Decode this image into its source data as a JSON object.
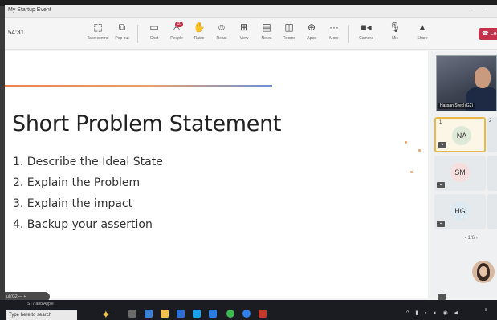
{
  "window": {
    "title": "My Startup Event"
  },
  "toolbar": {
    "timer": "54:31",
    "buttons": [
      {
        "label": "Take control",
        "icon": "take-control-icon"
      },
      {
        "label": "Pop out",
        "icon": "pop-out-icon"
      },
      {
        "label": "Chat",
        "icon": "chat-icon"
      },
      {
        "label": "People",
        "icon": "people-icon",
        "badge": "10"
      },
      {
        "label": "Raise",
        "icon": "raise-hand-icon"
      },
      {
        "label": "React",
        "icon": "react-icon"
      },
      {
        "label": "View",
        "icon": "view-icon"
      },
      {
        "label": "Notes",
        "icon": "notes-icon"
      },
      {
        "label": "Rooms",
        "icon": "rooms-icon"
      },
      {
        "label": "Apps",
        "icon": "apps-icon"
      },
      {
        "label": "More",
        "icon": "more-icon"
      },
      {
        "label": "Camera",
        "icon": "camera-icon"
      },
      {
        "label": "Mic",
        "icon": "mic-icon"
      },
      {
        "label": "Share",
        "icon": "share-icon"
      }
    ],
    "leave_label": "Le",
    "leave_color": "#c4314b"
  },
  "slide": {
    "title": "Short Problem Statement",
    "items": [
      "1. Describe the Ideal State",
      "2. Explain the Problem",
      "3. Explain the impact",
      "4. Backup your assertion"
    ],
    "stage_label": "ul (G2"
  },
  "participants": {
    "presenter_name": "Hassan Syed (G2)",
    "tiles": [
      {
        "initials": "NA",
        "number": "1",
        "color": "#dfe9d8",
        "active": true
      },
      {
        "initials": "SM",
        "color": "#f7dede",
        "active": false
      },
      {
        "initials": "HG",
        "color": "#dde9f0",
        "active": false
      }
    ],
    "right_number": "2",
    "pager": "1/6"
  },
  "taskbar": {
    "search_placeholder": "Type here to search",
    "above_search": "ST7 and Apple",
    "clock": "8"
  },
  "colors": {
    "accent": "#c4314b",
    "active_tile": "#e8b84a"
  }
}
